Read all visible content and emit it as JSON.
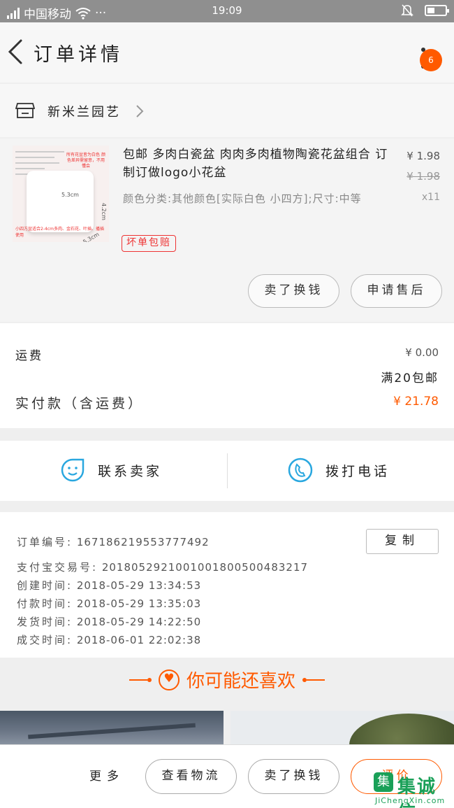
{
  "status_bar": {
    "carrier": "中国移动",
    "dots": "···",
    "time": "19:09"
  },
  "header": {
    "title": "订单详情",
    "notification_count": "6"
  },
  "shop": {
    "name": "新米兰园艺"
  },
  "product": {
    "title": "包邮 多肉白瓷盆 肉肉多肉植物陶瓷花盆组合 订制订做logo小花盆",
    "sku": "颜色分类:其他颜色[实际白色 小四方];尺寸:中等",
    "tag": "坏单包赔",
    "price": "¥ 1.98",
    "original_price": "¥ 1.98",
    "quantity": "x11",
    "image": {
      "promo_text": "所有花盆皆为白色 颜色差异需留意，不用懂会",
      "bottom_text": "小四方盆适合2-4cm多肉、金石花、叶插、播插使用",
      "dim_width": "5.3cm",
      "dim_height": "4.2cm",
      "dim_depth": "5.3cm"
    },
    "actions": {
      "sell_label": "卖了换钱",
      "after_sale_label": "申请售后"
    }
  },
  "totals": {
    "shipping_label": "运费",
    "shipping_value": "¥ 0.00",
    "free_shipping_note": "满20包邮",
    "paid_label": "实付款（含运费）",
    "paid_value": "¥ 21.78"
  },
  "contact": {
    "seller_label": "联系卖家",
    "call_label": "拨打电话"
  },
  "order_info": {
    "copy_label": "复制",
    "rows": [
      {
        "key": "订单编号:",
        "value": "167186219553777492"
      },
      {
        "key": "支付宝交易号:",
        "value": "2018052921001001800500483217"
      },
      {
        "key": "创建时间:",
        "value": "2018-05-29 13:34:53"
      },
      {
        "key": "付款时间:",
        "value": "2018-05-29 13:35:03"
      },
      {
        "key": "发货时间:",
        "value": "2018-05-29 14:22:50"
      },
      {
        "key": "成交时间:",
        "value": "2018-06-01 22:02:38"
      }
    ]
  },
  "recommend": {
    "title": "你可能还喜欢"
  },
  "bottom_bar": {
    "more_label": "更多",
    "logistics_label": "查看物流",
    "sell_label": "卖了换钱",
    "review_label": "评价"
  },
  "watermark": {
    "name": "集诚信",
    "url": "JiChengXin.com",
    "logo_char": "集"
  },
  "colors": {
    "accent": "#ff5a00",
    "tag_red": "#e33333",
    "icon_blue": "#29a7df"
  }
}
